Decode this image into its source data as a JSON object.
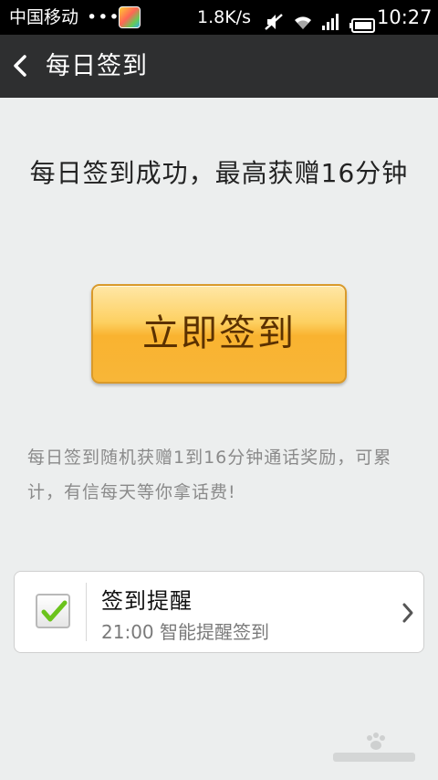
{
  "status_bar": {
    "carrier": "中国移动",
    "dots": "•••",
    "speed": "1.8K/s",
    "time": "10:27"
  },
  "header": {
    "title": "每日签到"
  },
  "main": {
    "headline": "每日签到成功，最高获赠16分钟",
    "signin_button": "立即签到",
    "description": "每日签到随机获赠1到16分钟通话奖励，可累计，有信每天等你拿话费!"
  },
  "reminder": {
    "title": "签到提醒",
    "subtitle": "21:00 智能提醒签到",
    "checked": true
  },
  "colors": {
    "status_bar_bg": "#000000",
    "title_bar_bg": "#2e2f30",
    "page_bg": "#eceeee",
    "button_orange": "#f9b330",
    "check_green": "#6bc31c"
  },
  "icons": [
    "back-icon",
    "mute-icon",
    "wifi-icon",
    "signal-icon",
    "battery-icon",
    "check-icon",
    "chevron-right-icon"
  ]
}
